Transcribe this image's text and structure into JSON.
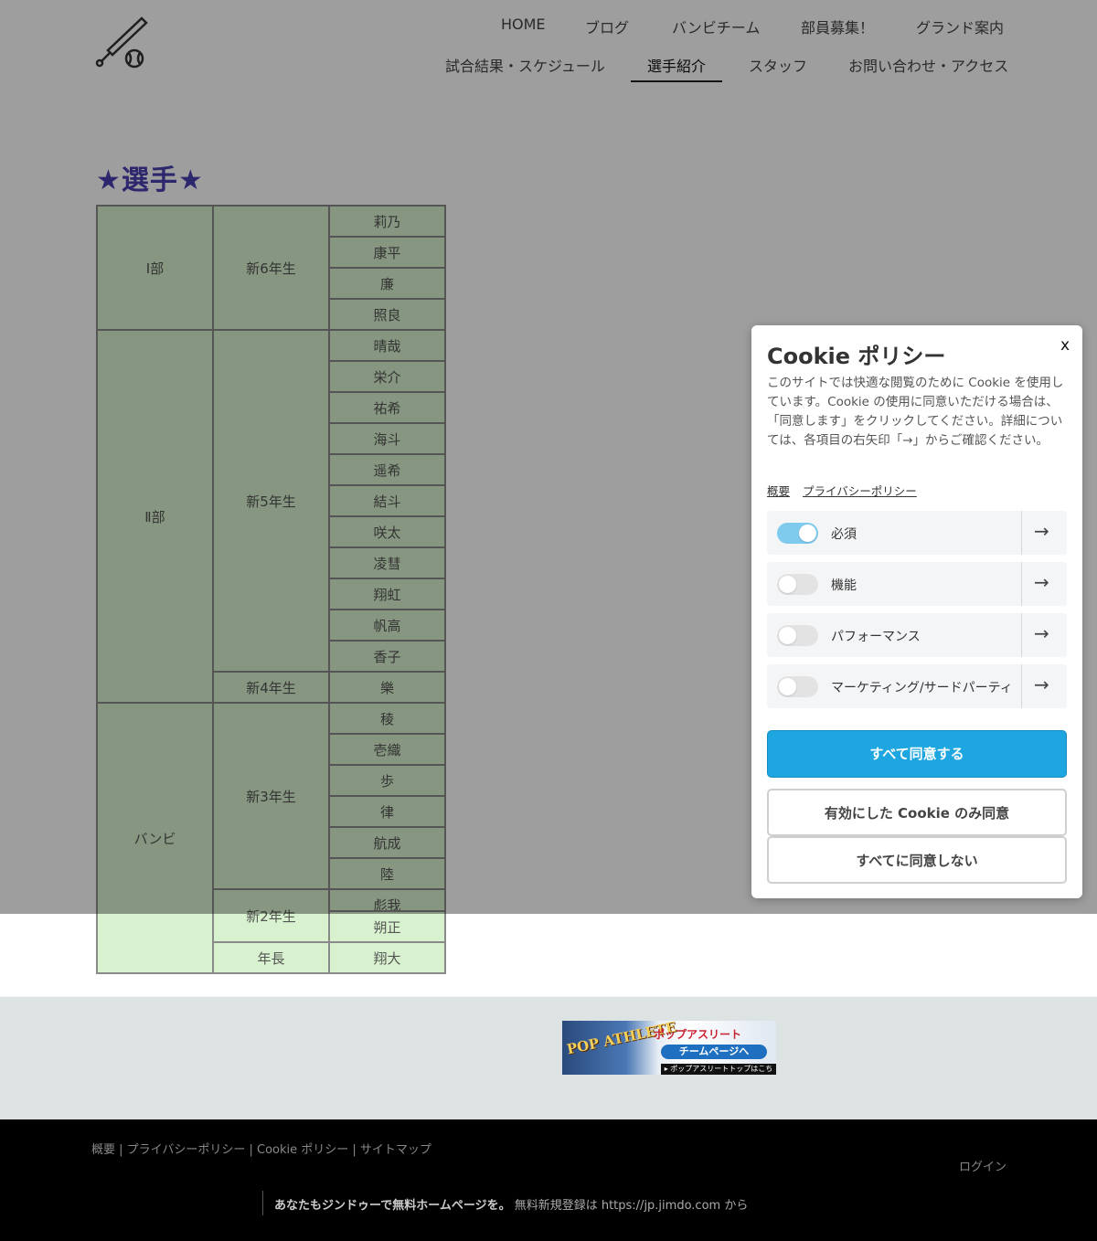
{
  "header": {
    "nav_row1": [
      "HOME",
      "ブログ",
      "バンビチーム",
      "部員募集！",
      "グランド案内"
    ],
    "nav_row2": [
      "試合結果・スケジュール",
      "選手紹介",
      "スタッフ",
      "お問い合わせ・アクセス"
    ],
    "selected": "選手紹介",
    "logo_icon": "baseball-bat-icon"
  },
  "main": {
    "heading": "★選手★",
    "roster": {
      "groups": [
        {
          "division": "Ⅰ部",
          "grades": [
            {
              "grade": "新6年生",
              "players": [
                "莉乃",
                "康平",
                "廉",
                "照良"
              ]
            }
          ]
        },
        {
          "division": "Ⅱ部",
          "grades": [
            {
              "grade": "新5年生",
              "players": [
                "晴哉",
                "栄介",
                "祐希",
                "海斗",
                "遥希",
                "結斗",
                "咲太",
                "凌彗",
                "翔虹",
                "帆高",
                "香子"
              ]
            },
            {
              "grade": "新4年生",
              "players": [
                "樂"
              ]
            }
          ]
        },
        {
          "division": "バンビ",
          "grades": [
            {
              "grade": "新3年生",
              "players": [
                "稜",
                "壱織",
                "歩",
                "律",
                "航成",
                "陸"
              ]
            },
            {
              "grade": "新2年生",
              "players": [
                "彪我",
                "朔正"
              ]
            },
            {
              "grade": "年長",
              "players": [
                "翔大"
              ]
            }
          ]
        }
      ]
    }
  },
  "footer": {
    "banner": {
      "logo": "POP ATHLETE",
      "title": "ポップアスリート",
      "cta": "チームページへ",
      "sub": "▸ ポップアスリートトップはこちら"
    },
    "links": "概要 | プライバシーポリシー | Cookie ポリシー | サイトマップ",
    "login": "ログイン",
    "jimdo_bold": "あなたもジンドゥーで無料ホームページを。",
    "jimdo_rest": " 無料新規登録は https://jp.jimdo.com から"
  },
  "cookie": {
    "close": "x",
    "title": "Cookie ポリシー",
    "body": "このサイトでは快適な閲覧のために Cookie を使用しています。Cookie の使用に同意いただける場合は、「同意します」をクリックしてください。詳細については、各項目の右矢印「→」からご確認ください。",
    "link_overview": "概要",
    "link_privacy": "プライバシーポリシー",
    "categories": [
      {
        "label": "必須",
        "enabled": true
      },
      {
        "label": "機能",
        "enabled": false
      },
      {
        "label": "パフォーマンス",
        "enabled": false
      },
      {
        "label": "マーケティング/サードパーティ",
        "enabled": false
      }
    ],
    "arrow": "→",
    "accept_all": "すべて同意する",
    "accept_selected": "有効にした Cookie のみ同意",
    "reject_all": "すべてに同意しない",
    "accent_color": "#1ea6e0"
  }
}
